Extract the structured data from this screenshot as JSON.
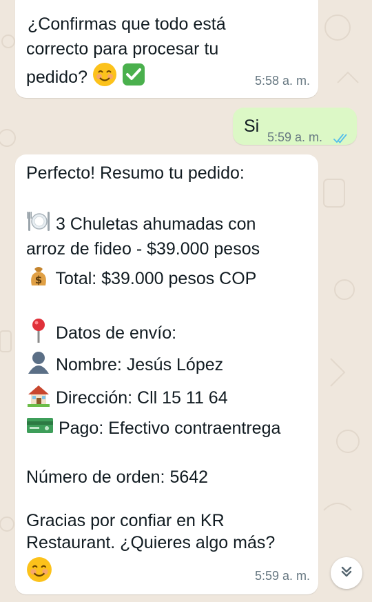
{
  "messages": {
    "confirm": {
      "text_line1": "¿Confirmas que todo está",
      "text_line2": "correcto para procesar tu",
      "text_line3": "pedido?",
      "time": "5:58 a. m."
    },
    "reply": {
      "text": "Si",
      "time": "5:59 a. m."
    },
    "summary": {
      "intro": "Perfecto! Resumo tu pedido:",
      "item_line1": "3 Chuletas ahumadas con",
      "item_line2": "arroz de fideo - $39.000 pesos",
      "total": "Total: $39.000 pesos COP",
      "shipping": "Datos de envío:",
      "name": "Nombre: Jesús López",
      "address": "Dirección: Cll 15 11 64",
      "payment": "Pago: Efectivo contraentrega",
      "order_number": "Número de orden: 5642",
      "thanks_line1": "Gracias por confiar en KR",
      "thanks_line2": "Restaurant. ¿Quieres algo más?",
      "time": "5:59 a. m."
    }
  },
  "icons": {
    "read_receipt": "double-check-icon",
    "scroll_down": "chevron-double-down-icon"
  },
  "colors": {
    "background": "#efe7dd",
    "incoming": "#ffffff",
    "outgoing": "#dcf8c6",
    "read_tick": "#53bdeb",
    "timestamp": "#667781"
  }
}
